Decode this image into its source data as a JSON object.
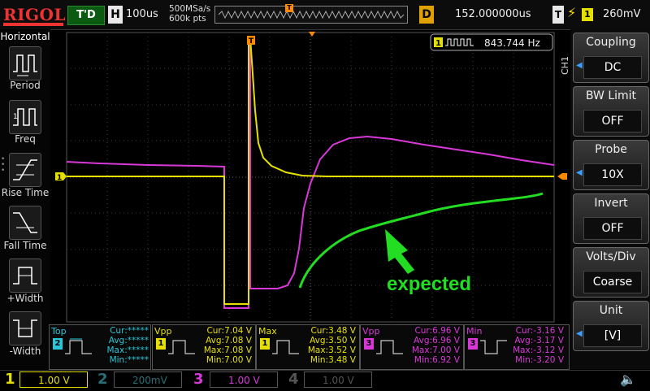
{
  "header": {
    "logo": "RIGOL",
    "trigger_status": "T'D",
    "horizontal_box": "H",
    "timebase": "100us",
    "sample_rate": "500MSa/s",
    "memory_depth": "600k pts",
    "delay_box": "D",
    "delay": "152.000000us",
    "trigger_box": "T",
    "trigger_edge": "⚡",
    "trigger_channel": "1",
    "trigger_level": "260mV"
  },
  "left_menu": {
    "title": "Horizontal",
    "items": [
      {
        "label": "Period",
        "icon": "period-icon"
      },
      {
        "label": "Freq",
        "icon": "frequency-icon"
      },
      {
        "label": "Rise Time",
        "icon": "rise-time-icon"
      },
      {
        "label": "Fall Time",
        "icon": "fall-time-icon"
      },
      {
        "label": "+Width",
        "icon": "positive-width-icon"
      },
      {
        "label": "-Width",
        "icon": "negative-width-icon"
      }
    ]
  },
  "right_menu": {
    "channel_tag": "CH1",
    "items": [
      {
        "title": "Coupling",
        "value": "DC",
        "arrow": true
      },
      {
        "title": "BW Limit",
        "value": "OFF",
        "arrow": false
      },
      {
        "title": "Probe",
        "value": "10X",
        "arrow": true
      },
      {
        "title": "Invert",
        "value": "OFF",
        "arrow": false
      },
      {
        "title": "Volts/Div",
        "value": "Coarse",
        "arrow": false
      },
      {
        "title": "Unit",
        "value": "[V]",
        "arrow": true
      }
    ]
  },
  "screen": {
    "frequency_badge_channel": "1",
    "frequency": "843.744 Hz",
    "trigger_marker": "T",
    "ch1_marker": "1",
    "annotation": "expected"
  },
  "measurements": [
    {
      "name": "Top",
      "channel": "2",
      "color": "#27c6d8",
      "cur": "Cur:*****",
      "avg": "Avg:*****",
      "max": "Max:*****",
      "min": "Min:*****"
    },
    {
      "name": "Vpp",
      "channel": "1",
      "color": "#e6e000",
      "cur": "Cur:7.04 V",
      "avg": "Avg:7.08 V",
      "max": "Max:7.08 V",
      "min": "Min:7.00 V"
    },
    {
      "name": "Max",
      "channel": "1",
      "color": "#e6e000",
      "cur": "Cur:3.48 V",
      "avg": "Avg:3.50 V",
      "max": "Max:3.52 V",
      "min": "Min:3.48 V"
    },
    {
      "name": "Vpp",
      "channel": "3",
      "color": "#d838d8",
      "cur": "Cur:6.96 V",
      "avg": "Avg:6.96 V",
      "max": "Max:7.00 V",
      "min": "Min:6.92 V"
    },
    {
      "name": "Min",
      "channel": "3",
      "color": "#d838d8",
      "cur": "Cur:-3.16 V",
      "avg": "Avg:-3.17 V",
      "max": "Max:-3.12 V",
      "min": "Min:-3.20 V"
    }
  ],
  "channels": [
    {
      "num": "1",
      "scale": "1.00 V",
      "color": "#e6e000",
      "active": true
    },
    {
      "num": "2",
      "scale": "200mV",
      "color": "#2a6f78",
      "active": false
    },
    {
      "num": "3",
      "scale": "1.00 V",
      "color": "#d838d8",
      "active": true
    },
    {
      "num": "4",
      "scale": "1.00 V",
      "color": "#555555",
      "active": false
    }
  ],
  "colors": {
    "ch1": "#e6e000",
    "ch2": "#27c6d8",
    "ch3": "#d838d8",
    "annotation": "#22dd22",
    "trigger": "#ff8a00"
  }
}
